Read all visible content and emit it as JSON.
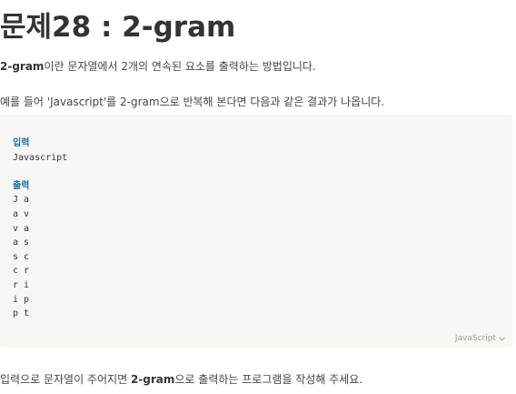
{
  "page": {
    "title": "문제28 : 2-gram",
    "intro": {
      "term": "2-gram",
      "rest": "이란 문자열에서 2개의 연속된 요소를 출력하는 방법입니다."
    },
    "example_sentence": "예를 들어 'Javascript'를 2-gram으로 반복해 본다면 다음과 같은 결과가 나옵니다.",
    "closing": {
      "before": "입력으로 문자열이 주어지면 ",
      "term": "2-gram",
      "after": "으로 출력하는 프로그램을 작성해 주세요."
    }
  },
  "code_block": {
    "input_label": "입력",
    "input_value": "Javascript",
    "output_label": "출력",
    "output_lines": [
      "J a",
      "a v",
      "v a",
      "a s",
      "s c",
      "c r",
      "r i",
      "i p",
      "p t"
    ],
    "language": "JavaScript",
    "language_icon": "chevron-down-icon"
  }
}
